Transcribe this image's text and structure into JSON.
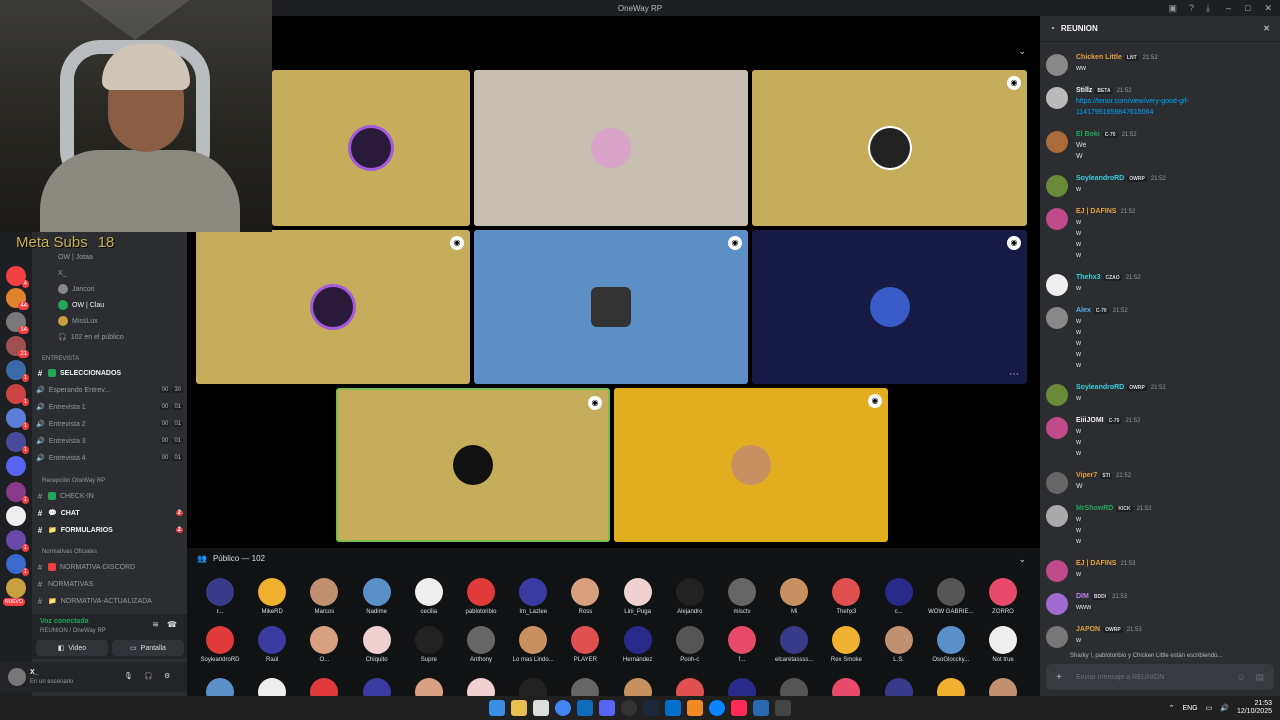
{
  "window": {
    "title": "OneWay RP"
  },
  "overlay": {
    "subs_label": "Meta Subs",
    "subs_count": "18"
  },
  "guild_badges": [
    "4",
    "44",
    "14",
    "21",
    "1",
    "1",
    "1",
    "1",
    "1",
    "1",
    "1",
    "NUEVO"
  ],
  "channels": {
    "stage_users": [
      "OW | Jotaa",
      "X_",
      "Jancori",
      "OW | Clau",
      "MissLux"
    ],
    "stage_listeners": "102 en el público",
    "cat_entrevista": "ENTREVISTA",
    "seleccionados": "SELECCIONADOS",
    "voice": [
      {
        "name": "Esperando Entrev...",
        "a": "00",
        "b": "30"
      },
      {
        "name": "Entrevista 1",
        "a": "00",
        "b": "01"
      },
      {
        "name": "Entrevista 2",
        "a": "00",
        "b": "01"
      },
      {
        "name": "Entrevista 3",
        "a": "00",
        "b": "01"
      },
      {
        "name": "Entrevista 4",
        "a": "00",
        "b": "01"
      }
    ],
    "cat_recepcion": "Recepción OneWay RP",
    "checkin": "CHECK-IN",
    "chat": "CHAT",
    "formularios": "FORMULARIOS",
    "cat_normativas": "Normativas Oficiales",
    "normativa_discord": "NORMATIVA-DISCORD",
    "normativas": "NORMATIVAS",
    "normativa_act": "NORMATIVA-ACTUALIZADA"
  },
  "voicebar": {
    "status": "Voz conectada",
    "location": "REUNION / OneWay RP",
    "video_label": "Video",
    "screen_label": "Pantalla"
  },
  "userbar": {
    "name": "X_",
    "status": "En un escenario"
  },
  "audience": {
    "title": "Público — 102",
    "row1": [
      "r...",
      "MikeRD",
      "Marcos",
      "Nadime",
      "cecilia",
      "pablotoribio",
      "Im_Lazlee",
      "Ross",
      "Lini_Puga",
      "Alejandro",
      "misctv",
      "Mi",
      "Thehx3",
      "c...",
      "WOW GABRIE...",
      "ZORRO"
    ],
    "row2": [
      "SoyleandroRD",
      "Raúl",
      "O...",
      "Chiquito",
      "Supre",
      "Anthony",
      "Lo mas Lindo...",
      "PLAYER",
      "Hernández",
      "Pooh-c",
      "f...",
      "elcaretassss...",
      "Rex Smoke",
      "L.S.",
      "OsoGloccky...",
      "Not true"
    ]
  },
  "chat": {
    "channel": "REUNION",
    "messages": [
      {
        "name": "Chicken Little",
        "tag": "LNT",
        "time": "21:52",
        "lines": [
          "ww"
        ]
      },
      {
        "name": "Stillz",
        "tag": "BETA",
        "time": "21:52",
        "lines": [
          "https://tenor.com/view/very-good-gif-",
          "11417951659847615064"
        ]
      },
      {
        "name": "El Boki",
        "tag": "C-70",
        "time": "21:52",
        "lines": [
          "We",
          "W"
        ]
      },
      {
        "name": "SoyleandroRD",
        "tag": "OWRP",
        "time": "21:52",
        "lines": [
          "w"
        ]
      },
      {
        "name": "EJ | DAFINS",
        "tag": "",
        "time": "21:52",
        "lines": [
          "w",
          "w",
          "w",
          "w"
        ]
      },
      {
        "name": "Thehx3",
        "tag": "CZAO",
        "time": "21:52",
        "lines": [
          "w"
        ]
      },
      {
        "name": "Alex",
        "tag": "C-70",
        "time": "21:52",
        "lines": [
          "w",
          "w",
          "w",
          "w",
          "w"
        ]
      },
      {
        "name": "SoyleandroRD",
        "tag": "OWRP",
        "time": "21:52",
        "lines": [
          "w"
        ]
      },
      {
        "name": "EiiiJOMI",
        "tag": "C-70",
        "time": "21:52",
        "lines": [
          "w",
          "w",
          "w"
        ]
      },
      {
        "name": "Viper7",
        "tag": "STI",
        "time": "21:52",
        "lines": [
          "W"
        ]
      },
      {
        "name": "MrShowRD",
        "tag": "KICK",
        "time": "21:52",
        "lines": [
          "w",
          "w",
          "w"
        ]
      },
      {
        "name": "EJ | DAFINS",
        "tag": "",
        "time": "21:53",
        "lines": [
          "w"
        ]
      },
      {
        "name": "DIM",
        "tag": "BDDI",
        "time": "21:53",
        "lines": [
          "www"
        ]
      },
      {
        "name": "JAPON",
        "tag": "OWRP",
        "time": "21:53",
        "lines": [
          "w"
        ]
      }
    ],
    "typing": "Sharky !, pablotoribio y Chicken Little están escribiendo...",
    "input_placeholder": "Enviar mensaje a REUNION"
  },
  "taskbar": {
    "lang": "ENG",
    "time": "21:53",
    "date": "12/10/2025"
  },
  "colors": {
    "tile_gold": "#c5ad5b",
    "tile_beige": "#c8bfb1",
    "tile_blue": "#5b8fc5",
    "tile_navy": "#171a45",
    "tile_yellow": "#e2ad1e"
  }
}
